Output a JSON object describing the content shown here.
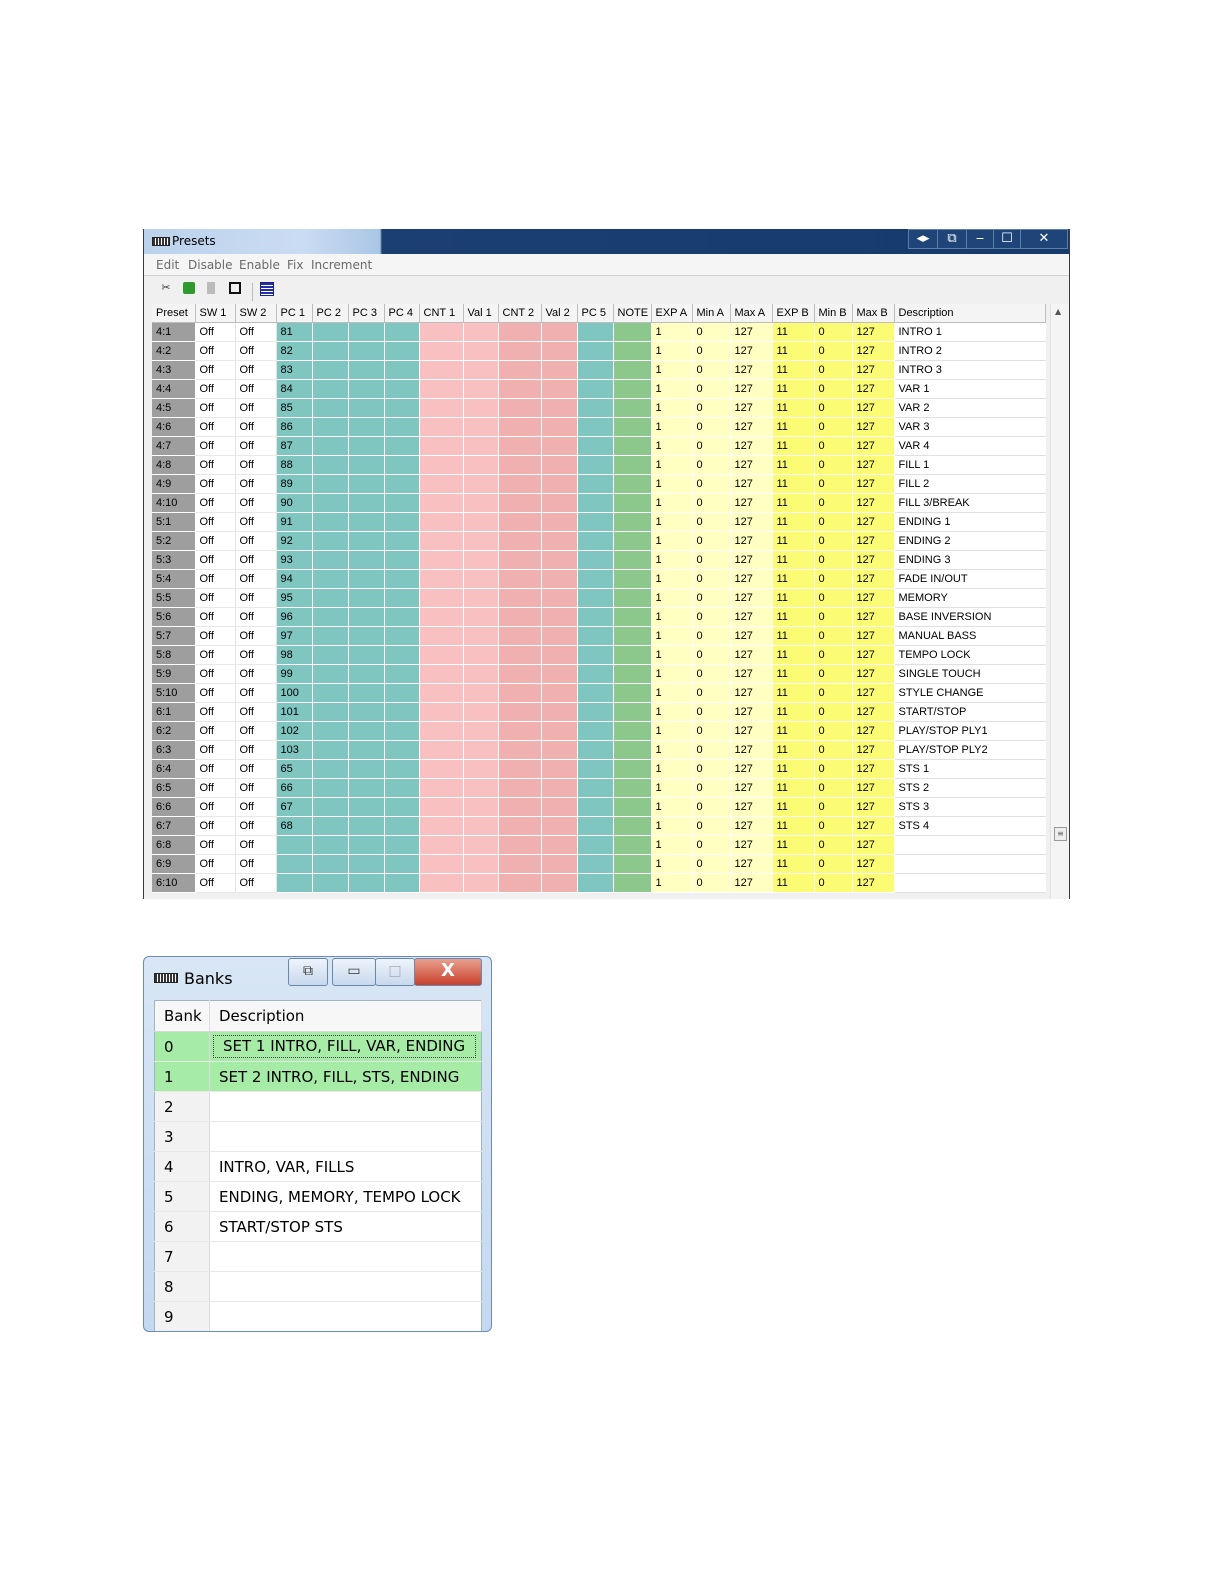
{
  "presets": {
    "title": "Presets",
    "window_controls": {
      "arrows": "◂▸",
      "restore": "⧉",
      "minimize": "‒",
      "maximize": "☐",
      "close": "✕"
    },
    "menu": [
      "Edit",
      "Disable",
      "Enable",
      "Fix",
      "Increment"
    ],
    "toolbar": {
      "icons": [
        "cut-icon",
        "copy-icon",
        "paste-icon",
        "select-icon",
        "list-icon"
      ]
    },
    "columns": [
      "Preset",
      "SW 1",
      "SW 2",
      "PC 1",
      "PC 2",
      "PC 3",
      "PC 4",
      "CNT 1",
      "Val 1",
      "CNT 2",
      "Val 2",
      "PC 5",
      "NOTE",
      "EXP A",
      "Min A",
      "Max A",
      "EXP B",
      "Min B",
      "Max B",
      "Description"
    ],
    "rows": [
      {
        "preset": "4:1",
        "sw1": "Off",
        "sw2": "Off",
        "pc1": "81",
        "exp_a": "1",
        "min_a": "0",
        "max_a": "127",
        "exp_b": "11",
        "min_b": "0",
        "max_b": "127",
        "description": "INTRO 1"
      },
      {
        "preset": "4:2",
        "sw1": "Off",
        "sw2": "Off",
        "pc1": "82",
        "exp_a": "1",
        "min_a": "0",
        "max_a": "127",
        "exp_b": "11",
        "min_b": "0",
        "max_b": "127",
        "description": "INTRO 2"
      },
      {
        "preset": "4:3",
        "sw1": "Off",
        "sw2": "Off",
        "pc1": "83",
        "exp_a": "1",
        "min_a": "0",
        "max_a": "127",
        "exp_b": "11",
        "min_b": "0",
        "max_b": "127",
        "description": "INTRO 3"
      },
      {
        "preset": "4:4",
        "sw1": "Off",
        "sw2": "Off",
        "pc1": "84",
        "exp_a": "1",
        "min_a": "0",
        "max_a": "127",
        "exp_b": "11",
        "min_b": "0",
        "max_b": "127",
        "description": "VAR 1"
      },
      {
        "preset": "4:5",
        "sw1": "Off",
        "sw2": "Off",
        "pc1": "85",
        "exp_a": "1",
        "min_a": "0",
        "max_a": "127",
        "exp_b": "11",
        "min_b": "0",
        "max_b": "127",
        "description": "VAR 2"
      },
      {
        "preset": "4:6",
        "sw1": "Off",
        "sw2": "Off",
        "pc1": "86",
        "exp_a": "1",
        "min_a": "0",
        "max_a": "127",
        "exp_b": "11",
        "min_b": "0",
        "max_b": "127",
        "description": "VAR 3"
      },
      {
        "preset": "4:7",
        "sw1": "Off",
        "sw2": "Off",
        "pc1": "87",
        "exp_a": "1",
        "min_a": "0",
        "max_a": "127",
        "exp_b": "11",
        "min_b": "0",
        "max_b": "127",
        "description": "VAR 4"
      },
      {
        "preset": "4:8",
        "sw1": "Off",
        "sw2": "Off",
        "pc1": "88",
        "exp_a": "1",
        "min_a": "0",
        "max_a": "127",
        "exp_b": "11",
        "min_b": "0",
        "max_b": "127",
        "description": "FILL 1"
      },
      {
        "preset": "4:9",
        "sw1": "Off",
        "sw2": "Off",
        "pc1": "89",
        "exp_a": "1",
        "min_a": "0",
        "max_a": "127",
        "exp_b": "11",
        "min_b": "0",
        "max_b": "127",
        "description": "FILL 2"
      },
      {
        "preset": "4:10",
        "sw1": "Off",
        "sw2": "Off",
        "pc1": "90",
        "exp_a": "1",
        "min_a": "0",
        "max_a": "127",
        "exp_b": "11",
        "min_b": "0",
        "max_b": "127",
        "description": "FILL 3/BREAK"
      },
      {
        "preset": "5:1",
        "sw1": "Off",
        "sw2": "Off",
        "pc1": "91",
        "exp_a": "1",
        "min_a": "0",
        "max_a": "127",
        "exp_b": "11",
        "min_b": "0",
        "max_b": "127",
        "description": "ENDING 1"
      },
      {
        "preset": "5:2",
        "sw1": "Off",
        "sw2": "Off",
        "pc1": "92",
        "exp_a": "1",
        "min_a": "0",
        "max_a": "127",
        "exp_b": "11",
        "min_b": "0",
        "max_b": "127",
        "description": "ENDING 2"
      },
      {
        "preset": "5:3",
        "sw1": "Off",
        "sw2": "Off",
        "pc1": "93",
        "exp_a": "1",
        "min_a": "0",
        "max_a": "127",
        "exp_b": "11",
        "min_b": "0",
        "max_b": "127",
        "description": "ENDING 3"
      },
      {
        "preset": "5:4",
        "sw1": "Off",
        "sw2": "Off",
        "pc1": "94",
        "exp_a": "1",
        "min_a": "0",
        "max_a": "127",
        "exp_b": "11",
        "min_b": "0",
        "max_b": "127",
        "description": "FADE IN/OUT"
      },
      {
        "preset": "5:5",
        "sw1": "Off",
        "sw2": "Off",
        "pc1": "95",
        "exp_a": "1",
        "min_a": "0",
        "max_a": "127",
        "exp_b": "11",
        "min_b": "0",
        "max_b": "127",
        "description": "MEMORY"
      },
      {
        "preset": "5:6",
        "sw1": "Off",
        "sw2": "Off",
        "pc1": "96",
        "exp_a": "1",
        "min_a": "0",
        "max_a": "127",
        "exp_b": "11",
        "min_b": "0",
        "max_b": "127",
        "description": "BASE INVERSION"
      },
      {
        "preset": "5:7",
        "sw1": "Off",
        "sw2": "Off",
        "pc1": "97",
        "exp_a": "1",
        "min_a": "0",
        "max_a": "127",
        "exp_b": "11",
        "min_b": "0",
        "max_b": "127",
        "description": "MANUAL BASS"
      },
      {
        "preset": "5:8",
        "sw1": "Off",
        "sw2": "Off",
        "pc1": "98",
        "exp_a": "1",
        "min_a": "0",
        "max_a": "127",
        "exp_b": "11",
        "min_b": "0",
        "max_b": "127",
        "description": "TEMPO LOCK"
      },
      {
        "preset": "5:9",
        "sw1": "Off",
        "sw2": "Off",
        "pc1": "99",
        "exp_a": "1",
        "min_a": "0",
        "max_a": "127",
        "exp_b": "11",
        "min_b": "0",
        "max_b": "127",
        "description": "SINGLE TOUCH"
      },
      {
        "preset": "5:10",
        "sw1": "Off",
        "sw2": "Off",
        "pc1": "100",
        "exp_a": "1",
        "min_a": "0",
        "max_a": "127",
        "exp_b": "11",
        "min_b": "0",
        "max_b": "127",
        "description": "STYLE CHANGE"
      },
      {
        "preset": "6:1",
        "sw1": "Off",
        "sw2": "Off",
        "pc1": "101",
        "exp_a": "1",
        "min_a": "0",
        "max_a": "127",
        "exp_b": "11",
        "min_b": "0",
        "max_b": "127",
        "description": "START/STOP"
      },
      {
        "preset": "6:2",
        "sw1": "Off",
        "sw2": "Off",
        "pc1": "102",
        "exp_a": "1",
        "min_a": "0",
        "max_a": "127",
        "exp_b": "11",
        "min_b": "0",
        "max_b": "127",
        "description": "PLAY/STOP PLY1"
      },
      {
        "preset": "6:3",
        "sw1": "Off",
        "sw2": "Off",
        "pc1": "103",
        "exp_a": "1",
        "min_a": "0",
        "max_a": "127",
        "exp_b": "11",
        "min_b": "0",
        "max_b": "127",
        "description": "PLAY/STOP PLY2"
      },
      {
        "preset": "6:4",
        "sw1": "Off",
        "sw2": "Off",
        "pc1": "65",
        "exp_a": "1",
        "min_a": "0",
        "max_a": "127",
        "exp_b": "11",
        "min_b": "0",
        "max_b": "127",
        "description": "STS 1"
      },
      {
        "preset": "6:5",
        "sw1": "Off",
        "sw2": "Off",
        "pc1": "66",
        "exp_a": "1",
        "min_a": "0",
        "max_a": "127",
        "exp_b": "11",
        "min_b": "0",
        "max_b": "127",
        "description": "STS 2"
      },
      {
        "preset": "6:6",
        "sw1": "Off",
        "sw2": "Off",
        "pc1": "67",
        "exp_a": "1",
        "min_a": "0",
        "max_a": "127",
        "exp_b": "11",
        "min_b": "0",
        "max_b": "127",
        "description": "STS 3"
      },
      {
        "preset": "6:7",
        "sw1": "Off",
        "sw2": "Off",
        "pc1": "68",
        "exp_a": "1",
        "min_a": "0",
        "max_a": "127",
        "exp_b": "11",
        "min_b": "0",
        "max_b": "127",
        "description": "STS 4"
      },
      {
        "preset": "6:8",
        "sw1": "Off",
        "sw2": "Off",
        "pc1": "",
        "exp_a": "1",
        "min_a": "0",
        "max_a": "127",
        "exp_b": "11",
        "min_b": "0",
        "max_b": "127",
        "description": ""
      },
      {
        "preset": "6:9",
        "sw1": "Off",
        "sw2": "Off",
        "pc1": "",
        "exp_a": "1",
        "min_a": "0",
        "max_a": "127",
        "exp_b": "11",
        "min_b": "0",
        "max_b": "127",
        "description": ""
      },
      {
        "preset": "6:10",
        "sw1": "Off",
        "sw2": "Off",
        "pc1": "",
        "exp_a": "1",
        "min_a": "0",
        "max_a": "127",
        "exp_b": "11",
        "min_b": "0",
        "max_b": "127",
        "description": ""
      }
    ],
    "colors": {
      "preset": "#9e9e9e",
      "pc": "#7fc5c0",
      "cnt": "#f8c0c0",
      "note": "#8cc88c",
      "exp_a": "#ffffc2",
      "exp_b": "#fcfc74",
      "titlebar": "#163a6c"
    }
  },
  "banks": {
    "title": "Banks",
    "window_controls": {
      "restore": "⧉",
      "minimize": "▭",
      "maximize": "□",
      "close": "X"
    },
    "columns": [
      "Bank",
      "Description"
    ],
    "rows": [
      {
        "bank": "0",
        "description": "SET 1 INTRO, FILL, VAR, ENDING",
        "selected": true,
        "focused": true
      },
      {
        "bank": "1",
        "description": "SET 2 INTRO, FILL, STS, ENDING",
        "selected": true
      },
      {
        "bank": "2",
        "description": ""
      },
      {
        "bank": "3",
        "description": ""
      },
      {
        "bank": "4",
        "description": "INTRO, VAR, FILLS"
      },
      {
        "bank": "5",
        "description": "ENDING, MEMORY, TEMPO LOCK"
      },
      {
        "bank": "6",
        "description": "START/STOP STS"
      },
      {
        "bank": "7",
        "description": ""
      },
      {
        "bank": "8",
        "description": ""
      },
      {
        "bank": "9",
        "description": ""
      }
    ],
    "colors": {
      "selected_row": "#a6eca6"
    }
  }
}
